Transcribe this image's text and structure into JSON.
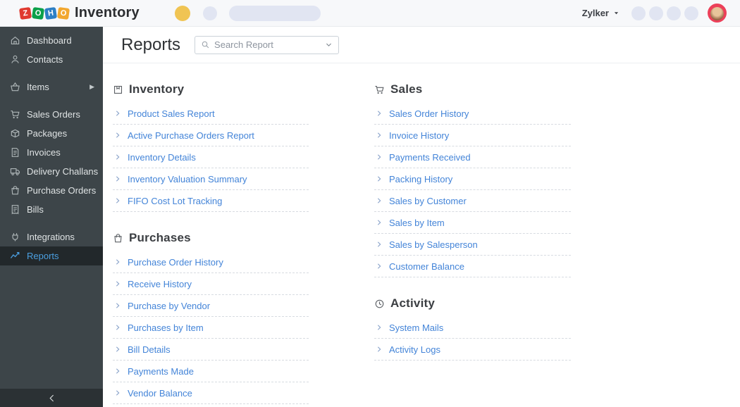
{
  "colors": {
    "topbar-bg": "#f7f8fa",
    "accent-dot": "#f0c453",
    "placeholder": "#e1e5f2",
    "avatar-ring": "#ec4059",
    "sidebar-bg": "#3d4549",
    "sidebar-active-bg": "#22282b",
    "sidebar-active-text": "#4b9fe0",
    "link": "#4384d8"
  },
  "topbar": {
    "logo_tiles": [
      {
        "letter": "Z",
        "color": "#e0392f"
      },
      {
        "letter": "O",
        "color": "#0ba04a"
      },
      {
        "letter": "H",
        "color": "#2d7fc5"
      },
      {
        "letter": "O",
        "color": "#f2a72e"
      }
    ],
    "app_name": "Inventory",
    "org_name": "Zylker",
    "org_caret_icon": "caret-down",
    "avatar_icon": "user-avatar"
  },
  "sidebar": {
    "groups": [
      {
        "items": [
          {
            "label": "Dashboard",
            "icon": "home"
          },
          {
            "label": "Contacts",
            "icon": "person"
          }
        ]
      },
      {
        "items": [
          {
            "label": "Items",
            "icon": "basket",
            "has_submenu": true
          }
        ]
      },
      {
        "items": [
          {
            "label": "Sales Orders",
            "icon": "cart"
          },
          {
            "label": "Packages",
            "icon": "package"
          },
          {
            "label": "Invoices",
            "icon": "invoice"
          },
          {
            "label": "Delivery Challans",
            "icon": "truck"
          },
          {
            "label": "Purchase Orders",
            "icon": "bag"
          },
          {
            "label": "Bills",
            "icon": "bill"
          }
        ]
      },
      {
        "items": [
          {
            "label": "Integrations",
            "icon": "integrations"
          },
          {
            "label": "Reports",
            "icon": "reports",
            "active": true
          }
        ]
      }
    ],
    "collapse_icon": "chevron-left"
  },
  "header": {
    "title": "Reports",
    "search_placeholder": "Search Report",
    "search_icon": "search",
    "select_caret_icon": "chevron-down"
  },
  "reports": {
    "columns": {
      "left": [
        {
          "title": "Inventory",
          "icon": "inventory",
          "reports": [
            "Product Sales Report",
            "Active Purchase Orders Report",
            "Inventory Details",
            "Inventory Valuation Summary",
            "FIFO Cost Lot Tracking"
          ]
        },
        {
          "title": "Purchases",
          "icon": "purchases",
          "reports": [
            "Purchase Order History",
            "Receive History",
            "Purchase by Vendor",
            "Purchases by Item",
            "Bill Details",
            "Payments Made",
            "Vendor Balance"
          ]
        }
      ],
      "right": [
        {
          "title": "Sales",
          "icon": "sales",
          "reports": [
            "Sales Order History",
            "Invoice History",
            "Payments Received",
            "Packing History",
            "Sales by Customer",
            "Sales by Item",
            "Sales by Salesperson",
            "Customer Balance"
          ]
        },
        {
          "title": "Activity",
          "icon": "activity",
          "reports": [
            "System Mails",
            "Activity Logs"
          ]
        }
      ]
    }
  }
}
